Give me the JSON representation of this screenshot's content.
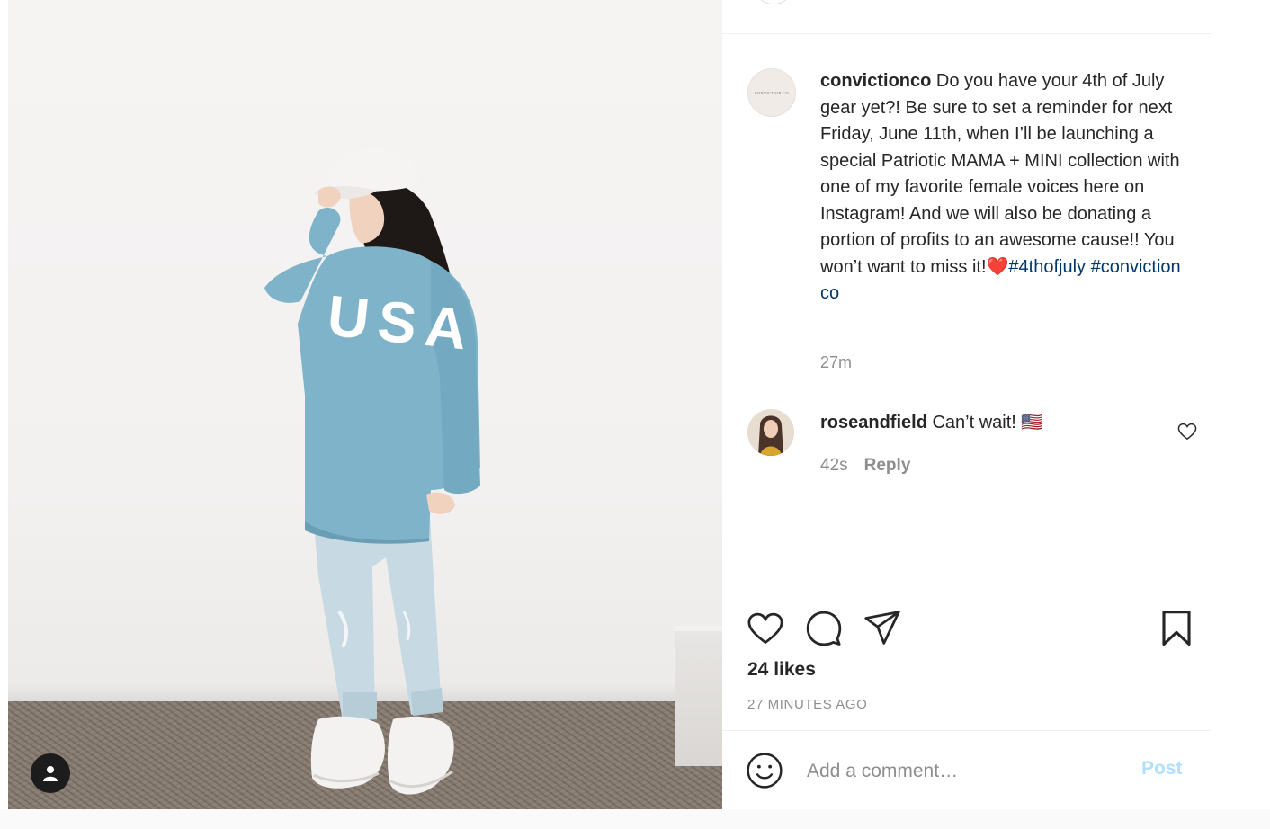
{
  "post": {
    "username": "convictionco",
    "avatar_text": "CONVICTION CO",
    "caption": "Do you have your 4th of July gear yet?! Be sure to set a reminder for next Friday, June 11th, when I’ll be launching a special Patriotic MAMA + MINI collection with one of my favorite female voices here on Instagram! And we will also be donating a portion of profits to an awesome cause!! You won’t want to miss it!",
    "heart_emoji": "❤️",
    "hashtags": [
      "#4thofjuly",
      "#conviction co"
    ],
    "time": "27m",
    "likes": "24 likes",
    "time_ago": "27 MINUTES AGO"
  },
  "comment": {
    "username": "roseandfield",
    "text": "Can’t wait! 🇺🇸",
    "time": "42s",
    "reply_label": "Reply"
  },
  "add_comment": {
    "placeholder": "Add a comment…",
    "post_label": "Post"
  },
  "photo": {
    "sweatshirt_text": "USA"
  },
  "icons": [
    "heart-icon",
    "comment-icon",
    "share-icon",
    "bookmark-icon",
    "emoji-icon",
    "user-tag-icon"
  ],
  "colors": {
    "hashtag": "#00376b",
    "secondary_text": "#8e8e8e",
    "post_button_disabled": "#b2dffc",
    "sweatshirt": "#7fb3ca"
  }
}
